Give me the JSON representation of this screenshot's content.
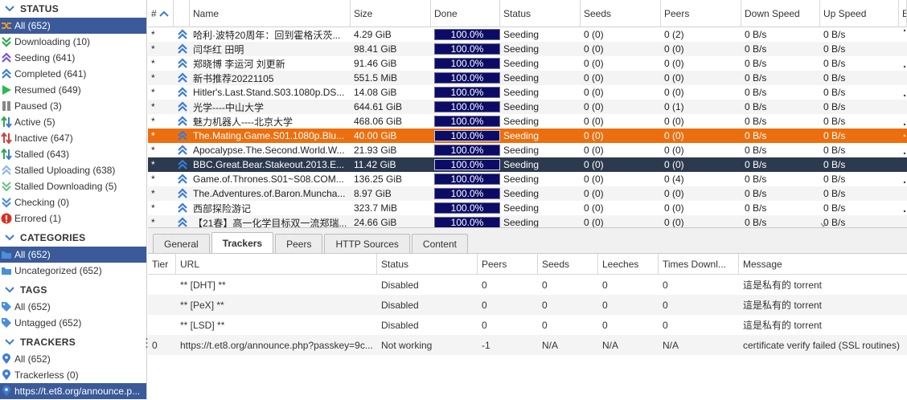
{
  "sidebar": {
    "status": {
      "title": "STATUS",
      "items": [
        {
          "icon": "all-status-icon",
          "label": "All (652)",
          "selected": true
        },
        {
          "icon": "downloading-icon",
          "label": "Downloading (10)"
        },
        {
          "icon": "seeding-icon",
          "label": "Seeding (641)"
        },
        {
          "icon": "completed-icon",
          "label": "Completed (641)"
        },
        {
          "icon": "resumed-icon",
          "label": "Resumed (649)"
        },
        {
          "icon": "paused-icon",
          "label": "Paused (3)"
        },
        {
          "icon": "active-icon",
          "label": "Active (5)"
        },
        {
          "icon": "inactive-icon",
          "label": "Inactive (647)"
        },
        {
          "icon": "stalled-icon",
          "label": "Stalled (643)"
        },
        {
          "icon": "stalled-uploading-icon",
          "label": "Stalled Uploading (638)"
        },
        {
          "icon": "stalled-downloading-icon",
          "label": "Stalled Downloading (5)"
        },
        {
          "icon": "checking-icon",
          "label": "Checking (0)"
        },
        {
          "icon": "errored-icon",
          "label": "Errored (1)"
        }
      ]
    },
    "categories": {
      "title": "CATEGORIES",
      "items": [
        {
          "label": "All (652)",
          "selected": true
        },
        {
          "label": "Uncategorized (652)"
        }
      ]
    },
    "tags": {
      "title": "TAGS",
      "items": [
        {
          "label": "All (652)"
        },
        {
          "label": "Untagged (652)"
        }
      ]
    },
    "trackers": {
      "title": "TRACKERS",
      "items": [
        {
          "label": "All (652)"
        },
        {
          "label": "Trackerless (0)"
        },
        {
          "label": "https://t.et8.org/announce.p...",
          "selected": true
        }
      ]
    }
  },
  "torrents": {
    "columns": {
      "num": "#",
      "name": "Name",
      "size": "Size",
      "done": "Done",
      "status": "Status",
      "seeds": "Seeds",
      "peers": "Peers",
      "down": "Down Speed",
      "up": "Up Speed",
      "extra": "E"
    },
    "rows": [
      {
        "num": "*",
        "name": "哈利·波特20周年：回到霍格沃茨...",
        "size": "4.29 GiB",
        "done": "100.0%",
        "status": "Seeding",
        "seeds": "0 (0)",
        "peers": "0 (2)",
        "down": "0 B/s",
        "up": "0 B/s"
      },
      {
        "num": "*",
        "name": "闫华红 田明",
        "size": "98.41 GiB",
        "done": "100.0%",
        "status": "Seeding",
        "seeds": "0 (0)",
        "peers": "0 (0)",
        "down": "0 B/s",
        "up": "0 B/s"
      },
      {
        "num": "*",
        "name": "郑晓博 李运河 刘更新",
        "size": "91.46 GiB",
        "done": "100.0%",
        "status": "Seeding",
        "seeds": "0 (0)",
        "peers": "0 (0)",
        "down": "0 B/s",
        "up": "0 B/s"
      },
      {
        "num": "*",
        "name": "新书推荐20221105",
        "size": "551.5 MiB",
        "done": "100.0%",
        "status": "Seeding",
        "seeds": "0 (0)",
        "peers": "0 (0)",
        "down": "0 B/s",
        "up": "0 B/s"
      },
      {
        "num": "*",
        "name": "Hitler's.Last.Stand.S03.1080p.DS...",
        "size": "14.08 GiB",
        "done": "100.0%",
        "status": "Seeding",
        "seeds": "0 (0)",
        "peers": "0 (0)",
        "down": "0 B/s",
        "up": "0 B/s"
      },
      {
        "num": "*",
        "name": "光学----中山大学",
        "size": "644.61 GiB",
        "done": "100.0%",
        "status": "Seeding",
        "seeds": "0 (0)",
        "peers": "0 (1)",
        "down": "0 B/s",
        "up": "0 B/s"
      },
      {
        "num": "*",
        "name": "魅力机器人----北京大学",
        "size": "468.06 GiB",
        "done": "100.0%",
        "status": "Seeding",
        "seeds": "0 (0)",
        "peers": "0 (0)",
        "down": "0 B/s",
        "up": "0 B/s"
      },
      {
        "num": "*",
        "name": "The.Mating.Game.S01.1080p.Blu...",
        "size": "40.00 GiB",
        "done": "100.0%",
        "status": "Seeding",
        "seeds": "0 (0)",
        "peers": "0 (0)",
        "down": "0 B/s",
        "up": "0 B/s",
        "highlight": "orange"
      },
      {
        "num": "*",
        "name": "Apocalypse.The.Second.World.W...",
        "size": "21.93 GiB",
        "done": "100.0%",
        "status": "Seeding",
        "seeds": "0 (0)",
        "peers": "0 (0)",
        "down": "0 B/s",
        "up": "0 B/s"
      },
      {
        "num": "*",
        "name": "BBC.Great.Bear.Stakeout.2013.E...",
        "size": "11.42 GiB",
        "done": "100.0%",
        "status": "Seeding",
        "seeds": "0 (0)",
        "peers": "0 (0)",
        "down": "0 B/s",
        "up": "0 B/s",
        "highlight": "dark"
      },
      {
        "num": "*",
        "name": "Game.of.Thrones.S01~S08.COM...",
        "size": "136.25 GiB",
        "done": "100.0%",
        "status": "Seeding",
        "seeds": "0 (0)",
        "peers": "0 (4)",
        "down": "0 B/s",
        "up": "0 B/s"
      },
      {
        "num": "*",
        "name": "The.Adventures.of.Baron.Muncha...",
        "size": "8.97 GiB",
        "done": "100.0%",
        "status": "Seeding",
        "seeds": "0 (0)",
        "peers": "0 (0)",
        "down": "0 B/s",
        "up": "0 B/s"
      },
      {
        "num": "*",
        "name": "西部探险游记",
        "size": "323.7 MiB",
        "done": "100.0%",
        "status": "Seeding",
        "seeds": "0 (0)",
        "peers": "0 (0)",
        "down": "0 B/s",
        "up": "0 B/s"
      },
      {
        "num": "*",
        "name": "【21春】高一化学目标双一流郑瑞...",
        "size": "24.66 GiB",
        "done": "100.0%",
        "status": "Seeding",
        "seeds": "0 (0)",
        "peers": "0 (0)",
        "down": "0 B/s",
        "up": "0 B/s"
      }
    ]
  },
  "details": {
    "tabs": [
      {
        "label": "General"
      },
      {
        "label": "Trackers",
        "active": true
      },
      {
        "label": "Peers"
      },
      {
        "label": "HTTP Sources"
      },
      {
        "label": "Content"
      }
    ],
    "columns": {
      "tier": "Tier",
      "url": "URL",
      "status": "Status",
      "peers": "Peers",
      "seeds": "Seeds",
      "leeches": "Leeches",
      "downloaded": "Times Downl...",
      "message": "Message"
    },
    "rows": [
      {
        "tier": "",
        "url": "** [DHT] **",
        "status": "Disabled",
        "peers": "0",
        "seeds": "0",
        "leeches": "0",
        "downloaded": "0",
        "message": "這是私有的 torrent"
      },
      {
        "tier": "",
        "url": "** [PeX] **",
        "status": "Disabled",
        "peers": "0",
        "seeds": "0",
        "leeches": "0",
        "downloaded": "0",
        "message": "這是私有的 torrent"
      },
      {
        "tier": "",
        "url": "** [LSD] **",
        "status": "Disabled",
        "peers": "0",
        "seeds": "0",
        "leeches": "0",
        "downloaded": "0",
        "message": "這是私有的 torrent"
      },
      {
        "tier": "0",
        "url": "https://t.et8.org/announce.php?passkey=9c...",
        "status": "Not working",
        "peers": "-1",
        "seeds": "N/A",
        "leeches": "N/A",
        "downloaded": "N/A",
        "message": "certificate verify failed (SSL routines)"
      }
    ]
  },
  "colors": {
    "selection": "#3a5a9a",
    "row_orange": "#ec6f0f",
    "row_dark": "#2b3a4e",
    "progress": "#0c0c66",
    "priority_icon": "#3a7bd5"
  }
}
